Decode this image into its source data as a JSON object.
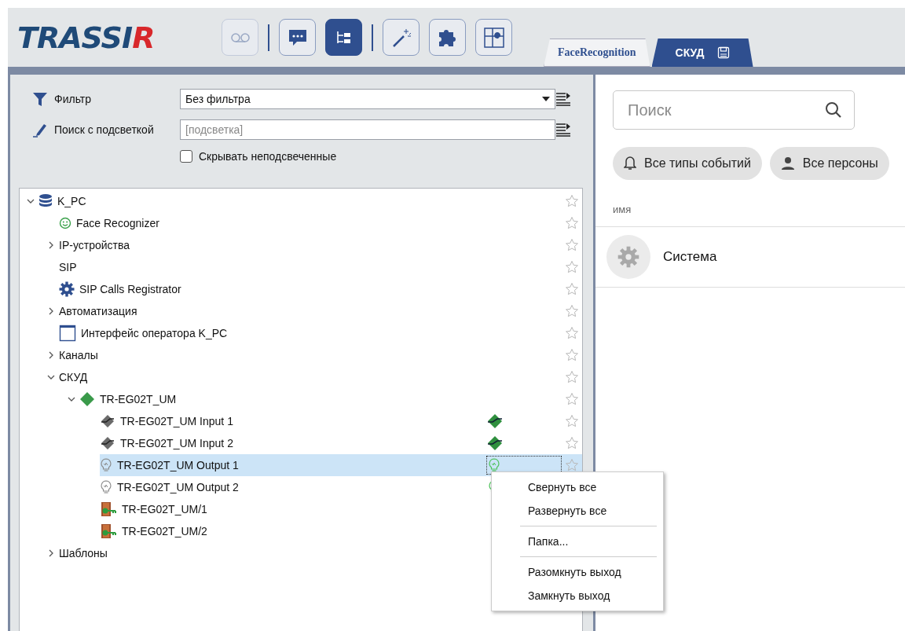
{
  "logo": {
    "text": "TRASSIR"
  },
  "toolbar": [
    {
      "kind": "tape",
      "selected": false,
      "disabled": true,
      "separator_before": false
    },
    {
      "kind": "chat",
      "selected": false,
      "disabled": false,
      "separator_before": true
    },
    {
      "kind": "tree",
      "selected": true,
      "disabled": false,
      "separator_before": false
    },
    {
      "kind": "wand",
      "selected": false,
      "disabled": false,
      "separator_before": true
    },
    {
      "kind": "puzzle",
      "selected": false,
      "disabled": false,
      "separator_before": false
    },
    {
      "kind": "grid",
      "selected": false,
      "disabled": false,
      "separator_before": false
    }
  ],
  "tabs": [
    {
      "label": "FaceRecognition",
      "selected": false,
      "save_icon": false
    },
    {
      "label": "СКУД",
      "selected": true,
      "save_icon": true
    }
  ],
  "filters": {
    "filter_label": "Фильтр",
    "filter_value": "Без фильтра",
    "search_label": "Поиск с подсветкой",
    "search_placeholder": "[подсветка]",
    "hide_label": "Скрывать неподсвеченные",
    "hide_checked": false
  },
  "tree": [
    {
      "label": "K_PC",
      "kind": "database",
      "expanded": true,
      "selected": false,
      "children": [
        {
          "label": "Face Recognizer",
          "kind": "smiley",
          "selected": false
        },
        {
          "label": "IP-устройства",
          "kind": "folder",
          "expanded": false,
          "selected": false
        },
        {
          "label": "SIP",
          "kind": "folder",
          "selected": false
        },
        {
          "label": "SIP Calls Registrator",
          "kind": "gear",
          "selected": false
        },
        {
          "label": "Автоматизация",
          "kind": "folder",
          "expanded": false,
          "selected": false
        },
        {
          "label": "Интерфейс оператора K_PC",
          "kind": "window",
          "selected": false
        },
        {
          "label": "Каналы",
          "kind": "folder",
          "expanded": false,
          "selected": false
        },
        {
          "label": "СКУД",
          "kind": "folder",
          "expanded": true,
          "selected": false,
          "children": [
            {
              "label": "TR-EG02T_UM",
              "kind": "diamond",
              "expanded": true,
              "selected": false,
              "children": [
                {
                  "label": "TR-EG02T_UM Input 1",
                  "kind": "input",
                  "selected": false
                },
                {
                  "label": "TR-EG02T_UM Input 2",
                  "kind": "input",
                  "selected": false
                },
                {
                  "label": "TR-EG02T_UM Output 1",
                  "kind": "output",
                  "selected": true
                },
                {
                  "label": "TR-EG02T_UM Output 2",
                  "kind": "output",
                  "selected": false
                },
                {
                  "label": "TR-EG02T_UM/1",
                  "kind": "door",
                  "selected": false
                },
                {
                  "label": "TR-EG02T_UM/2",
                  "kind": "door",
                  "selected": false
                }
              ]
            }
          ]
        },
        {
          "label": "Шаблоны",
          "kind": "folder",
          "expanded": false,
          "selected": false
        }
      ]
    }
  ],
  "context_menu": [
    [
      "Свернуть все",
      "Развернуть все"
    ],
    [
      "Папка..."
    ],
    [
      "Разомкнуть выход",
      "Замкнуть выход"
    ]
  ],
  "right": {
    "search_placeholder": "Поиск",
    "chips": [
      {
        "label": "Все типы событий",
        "kind": "bell"
      },
      {
        "label": "Все персоны",
        "kind": "person"
      }
    ],
    "column": "имя",
    "rows": [
      {
        "label": "Система",
        "kind": "system"
      }
    ]
  }
}
